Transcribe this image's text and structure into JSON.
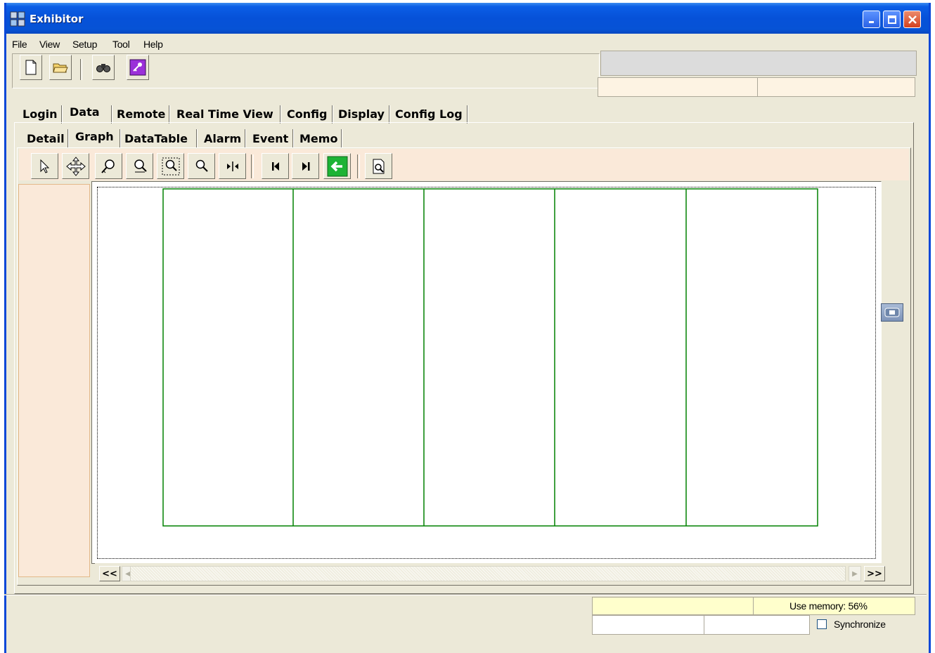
{
  "window": {
    "title": "Exhibitor"
  },
  "menu": [
    "File",
    "View",
    "Setup",
    "Tool",
    "Help"
  ],
  "toolbar": {
    "buttons": [
      "new-file-icon",
      "open-folder-icon",
      "find-binoculars-icon",
      "key-icon"
    ]
  },
  "main_tabs": [
    {
      "label": "Login"
    },
    {
      "label": "Data"
    },
    {
      "label": "Remote"
    },
    {
      "label": "Real Time View"
    },
    {
      "label": "Config"
    },
    {
      "label": "Display"
    },
    {
      "label": "Config Log"
    }
  ],
  "sub_tabs": [
    {
      "label": "Detail"
    },
    {
      "label": "Graph"
    },
    {
      "label": "DataTable"
    },
    {
      "label": "Alarm"
    },
    {
      "label": "Event"
    },
    {
      "label": "Memo"
    }
  ],
  "active_main_tab": "Data",
  "active_sub_tab": "Graph",
  "graph_toolbar": [
    "pointer-icon",
    "pan-icon",
    "zoom-in-icon",
    "zoom-out-icon",
    "zoom-box-icon",
    "zoom-reset-icon",
    "cursor-split-icon",
    "first-icon",
    "last-icon",
    "back-arrow-icon",
    "print-preview-icon"
  ],
  "scroll": {
    "left_label": "<<",
    "right_label": ">>"
  },
  "status": {
    "memory": "Use memory: 56%",
    "synchronize_label": "Synchronize",
    "synchronize_checked": false
  },
  "colors": {
    "grid": "#008000",
    "title_bar": "#0651d8",
    "panel_bg": "#fae9d9"
  }
}
